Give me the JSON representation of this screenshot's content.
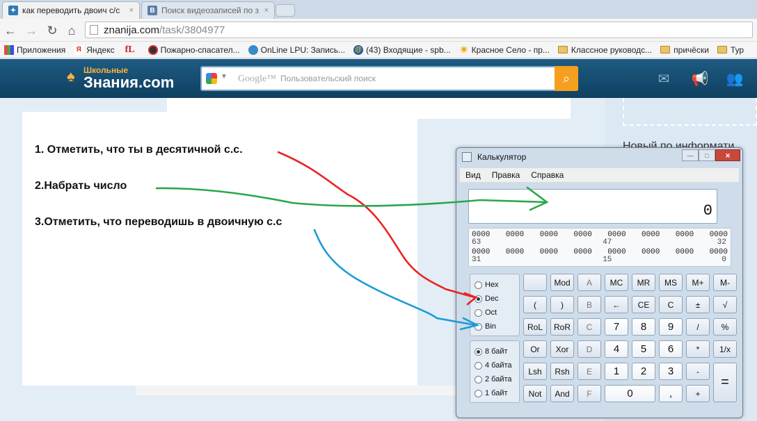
{
  "browser": {
    "tabs": [
      {
        "title": "как переводить двоич с/с",
        "close": "×",
        "favicon": "znanija-icon",
        "active": true
      },
      {
        "title": "Поиск видеозаписей по з",
        "close": "×",
        "favicon": "vk-icon",
        "favicon_text": "B",
        "active": false
      }
    ],
    "address": {
      "host": "znanija.com",
      "path": "/task/3804977"
    },
    "bookmarks": [
      {
        "label": "Приложения",
        "icon": "apps-icon"
      },
      {
        "label": "Яндекс",
        "icon": "yandex-icon",
        "icon_text": "Я"
      },
      {
        "label": "",
        "icon": "fl-icon",
        "icon_text": "fL"
      },
      {
        "label": "Пожарно-спасател...",
        "icon": "fire-rescue-icon"
      },
      {
        "label": "OnLine LPU: Запись...",
        "icon": "lpu-icon"
      },
      {
        "label": "(43) Входящие - spb...",
        "icon": "mail-icon"
      },
      {
        "label": "Красное Село - пр...",
        "icon": "sun-icon"
      },
      {
        "label": "Классное руководс...",
        "icon": "folder-icon"
      },
      {
        "label": "причёски",
        "icon": "folder-icon"
      },
      {
        "label": "Тур",
        "icon": "folder-icon"
      }
    ]
  },
  "site": {
    "logo_top": "Школьные",
    "logo_bottom": "Знания.com",
    "search_brand": "Google™",
    "search_placeholder": "Пользовательский поиск",
    "right_text": "Новый по информати"
  },
  "instructions": [
    "1. Отметить, что ты в десятичной с.с.",
    "2.Набрать число",
    "3.Отметить, что переводишь в двоичную с.с"
  ],
  "calculator": {
    "title": "Калькулятор",
    "window_buttons": {
      "minimize": "—",
      "maximize": "□",
      "close": "×"
    },
    "menu": [
      "Вид",
      "Правка",
      "Справка"
    ],
    "display_value": "0",
    "bits_rows": [
      {
        "groups": [
          "0000",
          "0000",
          "0000",
          "0000",
          "0000",
          "0000",
          "0000",
          "0000"
        ],
        "left_index": "63",
        "mid_index": "47",
        "right_index": "32"
      },
      {
        "groups": [
          "0000",
          "0000",
          "0000",
          "0000",
          "0000",
          "0000",
          "0000",
          "0000"
        ],
        "left_index": "31",
        "mid_index": "15",
        "right_index": "0"
      }
    ],
    "base_options": [
      {
        "label": "Hex",
        "selected": false
      },
      {
        "label": "Dec",
        "selected": true
      },
      {
        "label": "Oct",
        "selected": false
      },
      {
        "label": "Bin",
        "selected": false
      }
    ],
    "word_options": [
      {
        "label": "8 байт",
        "selected": true
      },
      {
        "label": "4 байта",
        "selected": false
      },
      {
        "label": "2 байта",
        "selected": false
      },
      {
        "label": "1 байт",
        "selected": false
      }
    ],
    "keys": [
      [
        "",
        "Mod",
        "A",
        "MC",
        "MR",
        "MS",
        "M+",
        "M-"
      ],
      [
        "(",
        ")",
        "B",
        "←",
        "CE",
        "C",
        "±",
        "√"
      ],
      [
        "RoL",
        "RoR",
        "C",
        "7",
        "8",
        "9",
        "/",
        "%"
      ],
      [
        "Or",
        "Xor",
        "D",
        "4",
        "5",
        "6",
        "*",
        "1/x"
      ],
      [
        "Lsh",
        "Rsh",
        "E",
        "1",
        "2",
        "3",
        "-",
        "="
      ],
      [
        "Not",
        "And",
        "F",
        "0",
        "",
        ",",
        "+",
        ""
      ]
    ]
  }
}
